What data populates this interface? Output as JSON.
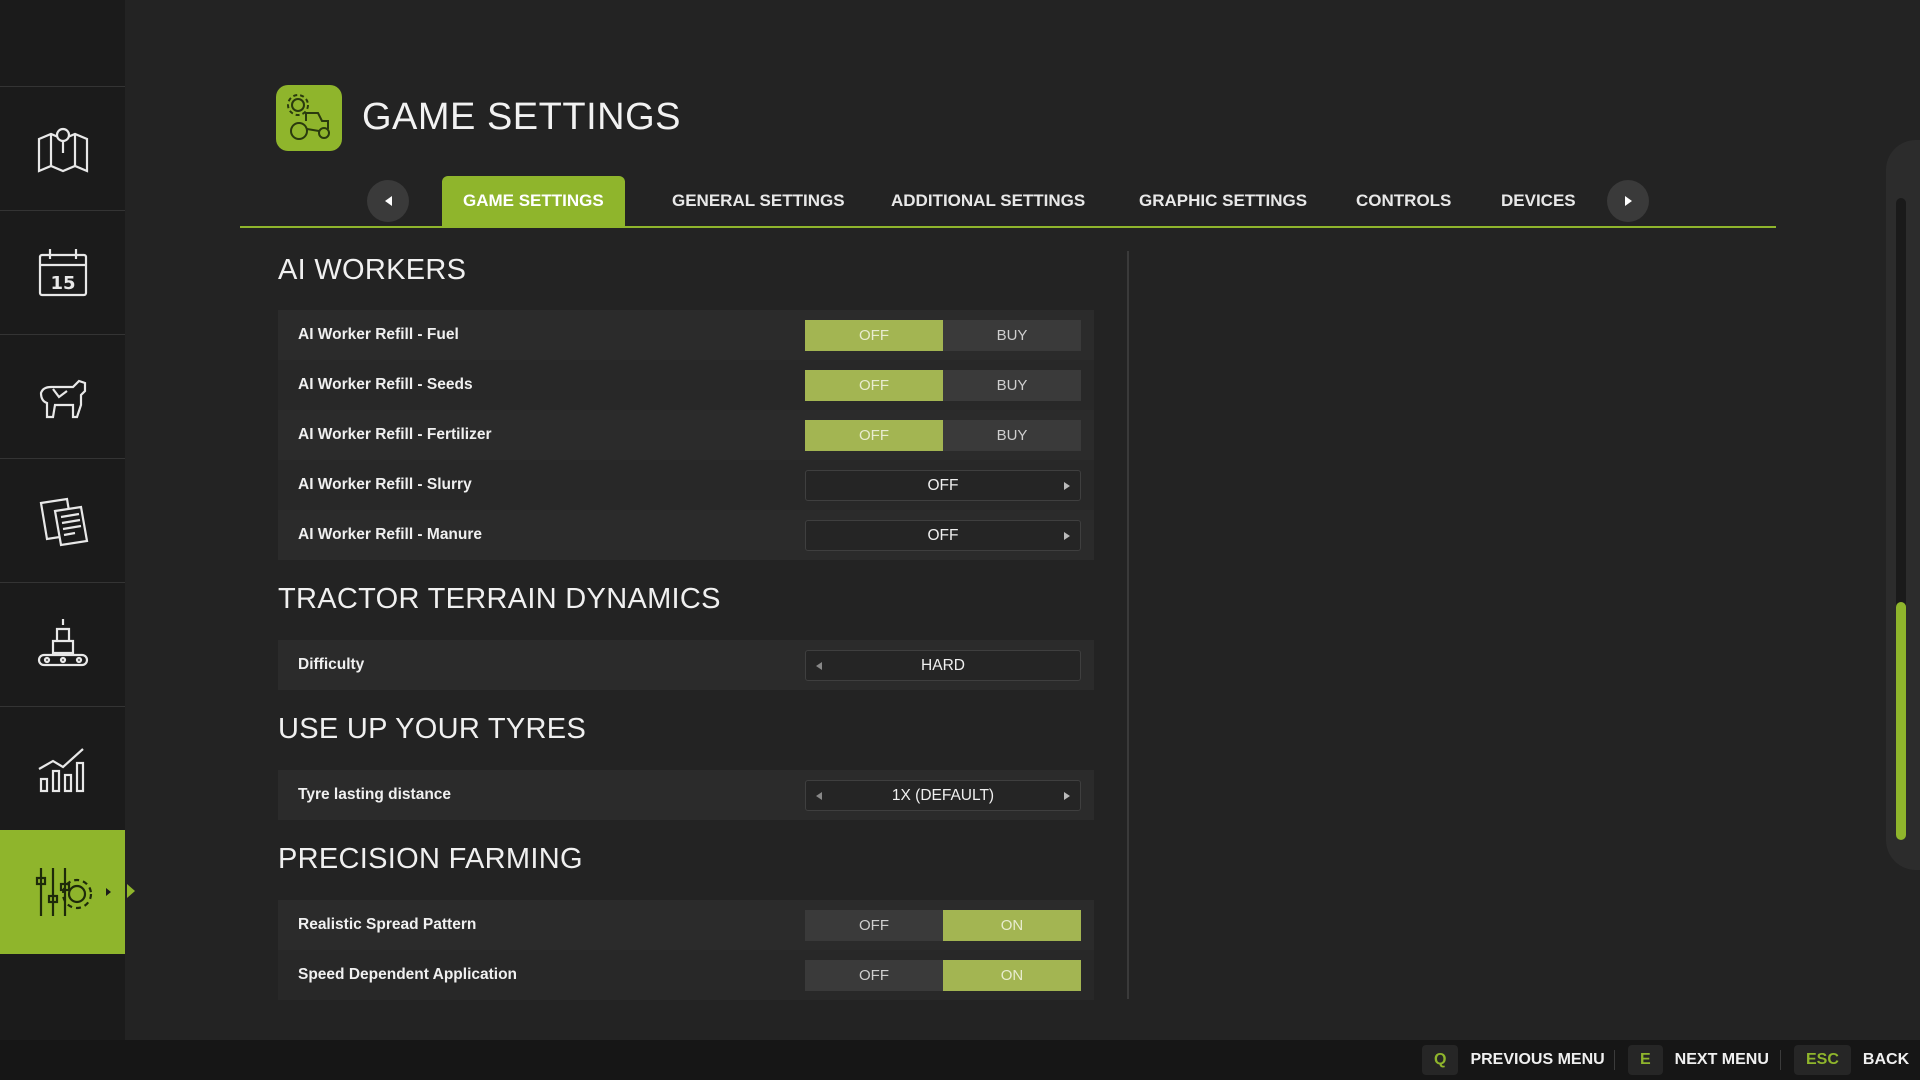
{
  "header": {
    "title": "GAME SETTINGS",
    "icon": "tractor-gear-icon",
    "accent": "#8fb52c"
  },
  "sidebar": {
    "items": [
      {
        "icon": "map-icon"
      },
      {
        "icon": "calendar-icon",
        "label": "15"
      },
      {
        "icon": "animals-icon"
      },
      {
        "icon": "contracts-icon"
      },
      {
        "icon": "production-icon"
      },
      {
        "icon": "statistics-icon"
      },
      {
        "icon": "settings-icon",
        "active": true
      }
    ]
  },
  "tabs": {
    "items": [
      {
        "label": "GAME SETTINGS",
        "active": true
      },
      {
        "label": "GENERAL SETTINGS"
      },
      {
        "label": "ADDITIONAL SETTINGS"
      },
      {
        "label": "GRAPHIC SETTINGS"
      },
      {
        "label": "CONTROLS"
      },
      {
        "label": "DEVICES"
      }
    ]
  },
  "sections": {
    "ai_workers": {
      "title": "AI WORKERS",
      "rows": [
        {
          "label": "AI Worker Refill - Fuel",
          "options": [
            "OFF",
            "BUY"
          ],
          "selected": "OFF"
        },
        {
          "label": "AI Worker Refill - Seeds",
          "options": [
            "OFF",
            "BUY"
          ],
          "selected": "OFF"
        },
        {
          "label": "AI Worker Refill - Fertilizer",
          "options": [
            "OFF",
            "BUY"
          ],
          "selected": "OFF"
        },
        {
          "label": "AI Worker Refill - Slurry",
          "value": "OFF"
        },
        {
          "label": "AI Worker Refill - Manure",
          "value": "OFF"
        }
      ]
    },
    "terrain": {
      "title": "TRACTOR TERRAIN DYNAMICS",
      "rows": [
        {
          "label": "Difficulty",
          "value": "HARD"
        }
      ]
    },
    "tyres": {
      "title": "USE UP YOUR TYRES",
      "rows": [
        {
          "label": "Tyre lasting distance",
          "value": "1X (DEFAULT)"
        }
      ]
    },
    "precision": {
      "title": "PRECISION FARMING",
      "rows": [
        {
          "label": "Realistic Spread Pattern",
          "options": [
            "OFF",
            "ON"
          ],
          "selected": "ON"
        },
        {
          "label": "Speed Dependent Application",
          "options": [
            "OFF",
            "ON"
          ],
          "selected": "ON"
        }
      ]
    }
  },
  "footer": {
    "hints": [
      {
        "key": "Q",
        "label": "PREVIOUS MENU"
      },
      {
        "key": "E",
        "label": "NEXT MENU"
      },
      {
        "key": "ESC",
        "label": "BACK"
      }
    ]
  }
}
